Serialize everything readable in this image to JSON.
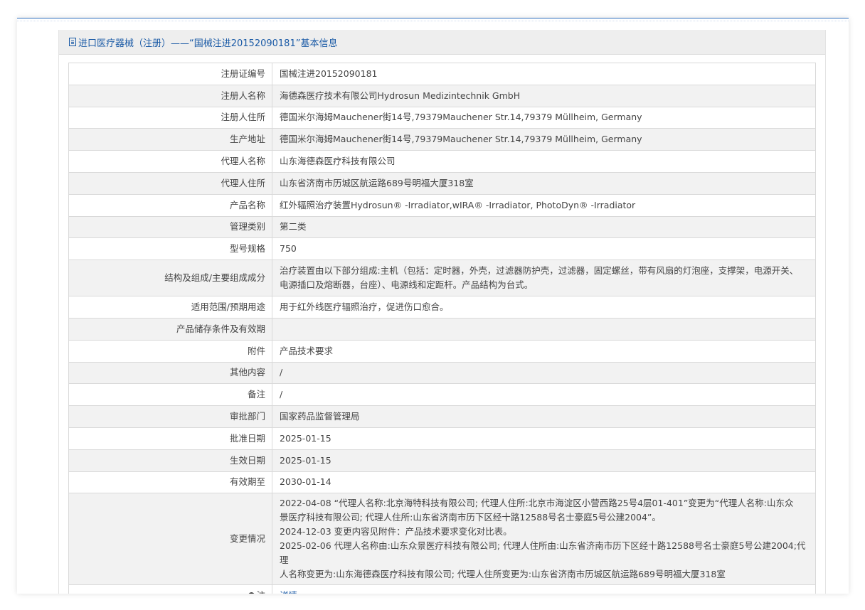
{
  "header": {
    "title": "进口医疗器械（注册）——“国械注进20152090181”基本信息",
    "icon": "document-icon"
  },
  "rows": [
    {
      "label": "注册证编号",
      "value": "国械注进20152090181"
    },
    {
      "label": "注册人名称",
      "value": "海德森医疗技术有限公司Hydrosun Medizintechnik GmbH"
    },
    {
      "label": "注册人住所",
      "value": "德国米尔海姆Mauchener街14号,79379Mauchener Str.14,79379 Müllheim, Germany"
    },
    {
      "label": "生产地址",
      "value": "德国米尔海姆Mauchener街14号,79379Mauchener Str.14,79379 Müllheim, Germany"
    },
    {
      "label": "代理人名称",
      "value": "山东海德森医疗科技有限公司"
    },
    {
      "label": "代理人住所",
      "value": "山东省济南市历城区航运路689号明福大厦318室"
    },
    {
      "label": "产品名称",
      "value": "红外辐照治疗装置Hydrosun® -Irradiator,wIRA® -Irradiator, PhotoDyn® -Irradiator"
    },
    {
      "label": "管理类别",
      "value": "第二类"
    },
    {
      "label": "型号规格",
      "value": "750"
    },
    {
      "label": "结构及组成/主要组成成分",
      "value_lines": [
        "治疗装置由以下部分组成:主机（包括：定时器，外壳，过滤器防护壳，过滤器，固定螺丝，带有风扇的灯泡座，支撑架，电源开关、",
        "电源插口及熔断器，台座）、电源线和定距杆。产品结构为台式。"
      ]
    },
    {
      "label": "适用范围/预期用途",
      "value": "用于红外线医疗辐照治疗，促进伤口愈合。"
    },
    {
      "label": "产品储存条件及有效期",
      "value": ""
    },
    {
      "label": "附件",
      "value": "产品技术要求"
    },
    {
      "label": "其他内容",
      "value": "/"
    },
    {
      "label": "备注",
      "value": "/"
    },
    {
      "label": "审批部门",
      "value": "国家药品监督管理局"
    },
    {
      "label": "批准日期",
      "value": "2025-01-15"
    },
    {
      "label": "生效日期",
      "value": "2025-01-15"
    },
    {
      "label": "有效期至",
      "value": "2030-01-14"
    },
    {
      "label": "变更情况",
      "value_lines": [
        "2022-04-08 “代理人名称:北京海特科技有限公司; 代理人住所:北京市海淀区小营西路25号4层01-401”变更为“代理人名称:山东众",
        "景医疗科技有限公司; 代理人住所:山东省济南市历下区经十路12588号名士豪庭5号公建2004”。",
        "2024-12-03 变更内容见附件：产品技术要求变化对比表。",
        "2025-02-06 代理人名称由:山东众景医疗科技有限公司; 代理人住所由:山东省济南市历下区经十路12588号名士豪庭5号公建2004;代理",
        "人名称变更为:山东海德森医疗科技有限公司; 代理人住所变更为:山东省济南市历城区航运路689号明福大厦318室"
      ]
    },
    {
      "label": "注",
      "value": "详情",
      "icon": "pin-icon"
    }
  ],
  "colors": {
    "accent": "#1a5aa6",
    "border": "#d9d9d9",
    "header_bg": "#eeeeee",
    "stripe": "#f2f2f2"
  }
}
